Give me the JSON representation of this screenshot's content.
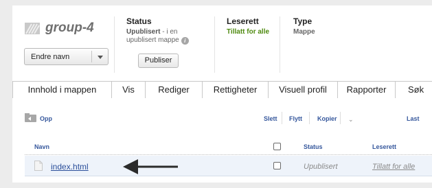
{
  "header": {
    "title": "group-4",
    "rename_label": "Endre navn",
    "status": {
      "heading": "Status",
      "value_bold": "Upublisert",
      "value_rest": " - i en upublisert mappe",
      "publish_label": "Publiser"
    },
    "read_access": {
      "heading": "Leserett",
      "value": "Tillatt for alle"
    },
    "type": {
      "heading": "Type",
      "value": "Mappe"
    }
  },
  "tabs": [
    "Innhold i mappen",
    "Vis",
    "Rediger",
    "Rettigheter",
    "Visuell profil",
    "Rapporter",
    "Søk"
  ],
  "active_tab": "Innhold i mappen",
  "toolbar": {
    "up": "Opp",
    "delete": "Slett",
    "move": "Flytt",
    "copy": "Kopier",
    "more_caret": "⌄",
    "upload": "Last"
  },
  "table": {
    "columns": {
      "name": "Navn",
      "status": "Status",
      "read_access": "Leserett"
    },
    "rows": [
      {
        "name": "index.html",
        "status": "Upublisert",
        "read_access": "Tillatt for alle"
      }
    ]
  },
  "colors": {
    "link": "#2a4e9a",
    "accent_green": "#4f8a10",
    "row_highlight": "#eef3fa"
  }
}
